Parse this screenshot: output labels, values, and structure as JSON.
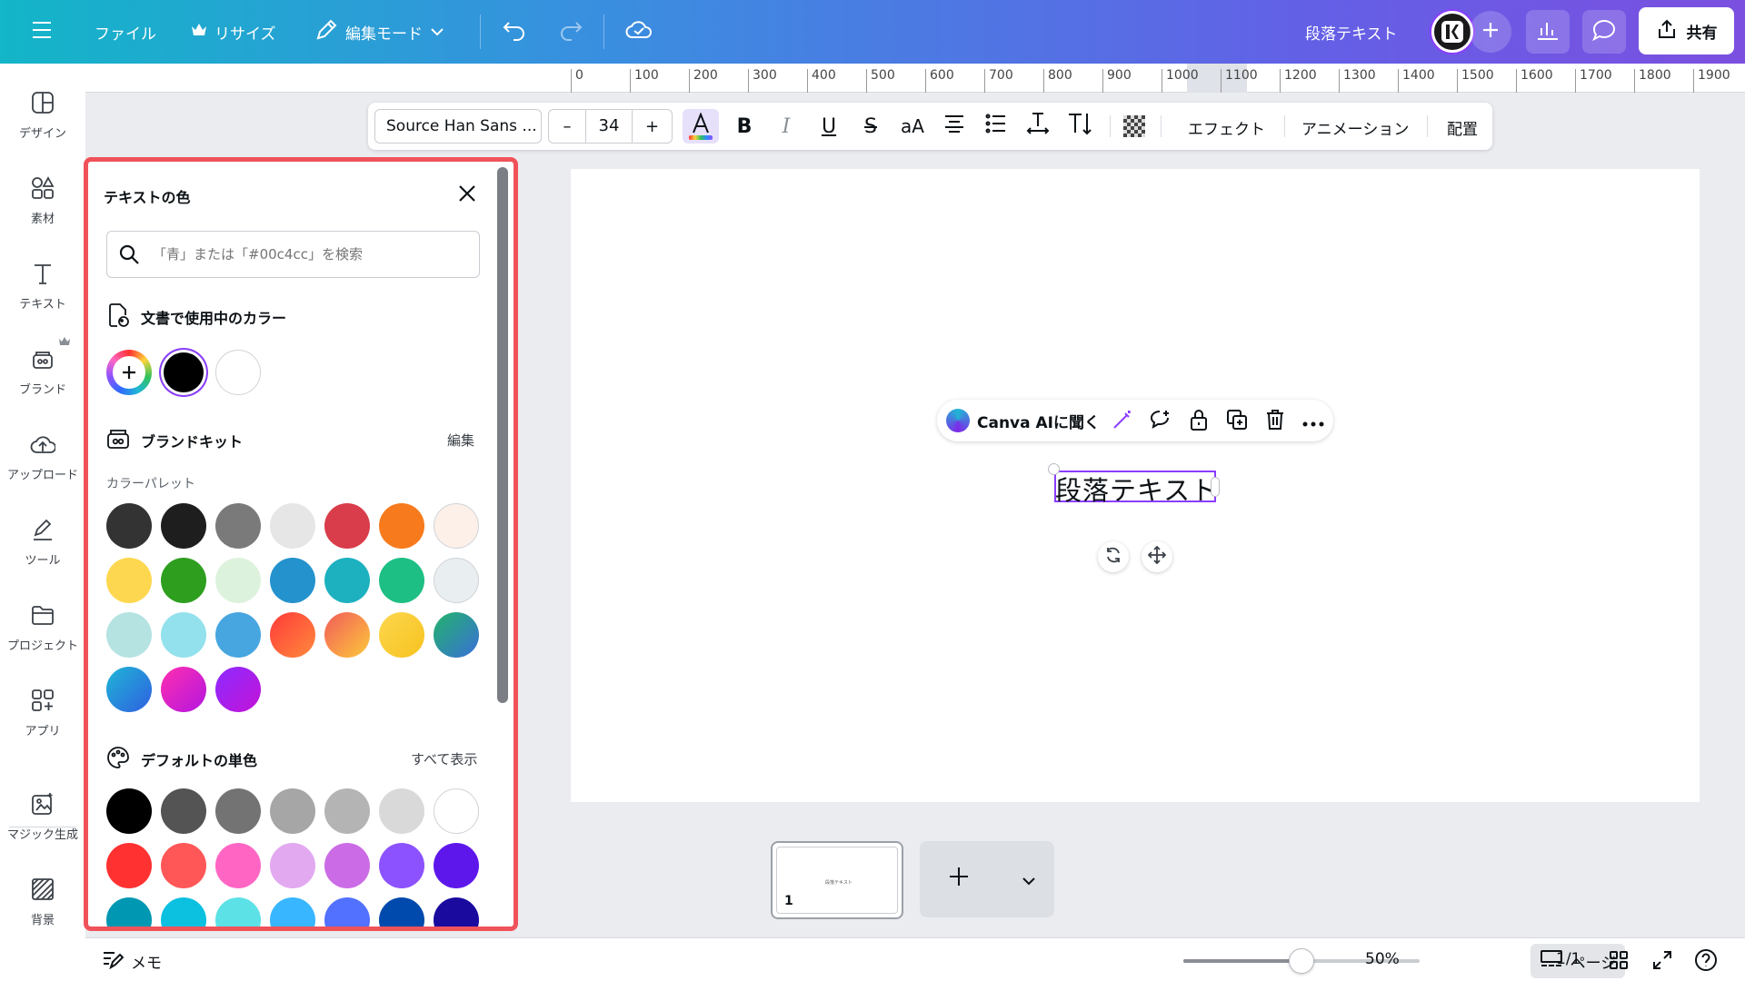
{
  "header": {
    "file_label": "ファイル",
    "resize_label": "リサイズ",
    "edit_mode_label": "編集モード",
    "doc_title": "段落テキスト",
    "share_label": "共有"
  },
  "rail": {
    "items": [
      {
        "label": "デザイン",
        "icon": "layout-icon"
      },
      {
        "label": "素材",
        "icon": "elements-icon"
      },
      {
        "label": "テキスト",
        "icon": "text-icon"
      },
      {
        "label": "ブランド",
        "icon": "brand-icon"
      },
      {
        "label": "アップロード",
        "icon": "upload-icon"
      },
      {
        "label": "ツール",
        "icon": "tools-icon"
      },
      {
        "label": "プロジェクト",
        "icon": "folder-icon"
      },
      {
        "label": "アプリ",
        "icon": "apps-icon"
      },
      {
        "label": "マジック生成",
        "icon": "magic-icon"
      },
      {
        "label": "背景",
        "icon": "background-icon"
      }
    ]
  },
  "ruler": {
    "ticks": [
      "0",
      "100",
      "200",
      "300",
      "400",
      "500",
      "600",
      "700",
      "800",
      "900",
      "1000",
      "1100",
      "1200",
      "1300",
      "1400",
      "1500",
      "1600",
      "1700",
      "1800",
      "1900"
    ]
  },
  "toolbar": {
    "font_name": "Source Han Sans ...",
    "font_size": "34",
    "minus": "–",
    "plus": "+",
    "bold": "B",
    "italic": "I",
    "underline": "U",
    "strike": "S",
    "case": "aA",
    "effects_label": "エフェクト",
    "animation_label": "アニメーション",
    "position_label": "配置"
  },
  "color_panel": {
    "title": "テキストの色",
    "search_placeholder": "「青」または「#00c4cc」を検索",
    "doc_colors_heading": "文書で使用中のカラー",
    "doc_colors": [
      "#000000",
      "#ffffff"
    ],
    "brand_kit_heading": "ブランドキット",
    "brand_kit_edit": "編集",
    "palette_label": "カラーパレット",
    "palette": [
      "#333333",
      "#1e1e1e",
      "#7a7a7a",
      "#e6e6e6",
      "#d93c4a",
      "#f77a1c",
      "#fdf0e8",
      "#fdd74f",
      "#2e9e1f",
      "#ddf2dc",
      "#2492cc",
      "#1db1c0",
      "#1dbf84",
      "#e9eef0",
      "#b5e3e1",
      "#92e1ec",
      "#47a6e0",
      "gradient-red-orange",
      "gradient-orange-yellow",
      "gradient-yellow",
      "gradient-green-blue",
      "gradient-blue",
      "gradient-pink",
      "gradient-purple"
    ],
    "default_heading": "デフォルトの単色",
    "show_all": "すべて表示",
    "default_colors": [
      "#000000",
      "#545454",
      "#737373",
      "#a6a6a6",
      "#b4b4b4",
      "#d9d9d9",
      "#ffffff",
      "#ff3131",
      "#ff5757",
      "#ff66c4",
      "#e2a9f1",
      "#cb6ce6",
      "#8c52ff",
      "#5e17eb",
      "#0097b2",
      "#0cc0df",
      "#5ce1e6",
      "#38b6ff",
      "#5271ff",
      "#004aad",
      "#1a0a9e"
    ]
  },
  "canvas": {
    "ask_ai_label": "Canva AIに聞く",
    "selected_text": "段落テキスト",
    "thumb_text": "段落テキスト",
    "page_number": "1"
  },
  "bottom": {
    "notes_label": "メモ",
    "zoom_value": "50%",
    "zoom_fraction": 0.5,
    "pages_label": "ページ",
    "page_count": "1/1"
  },
  "colors": {
    "accent": "#8b3dff",
    "highlight_border": "#f0525a"
  }
}
